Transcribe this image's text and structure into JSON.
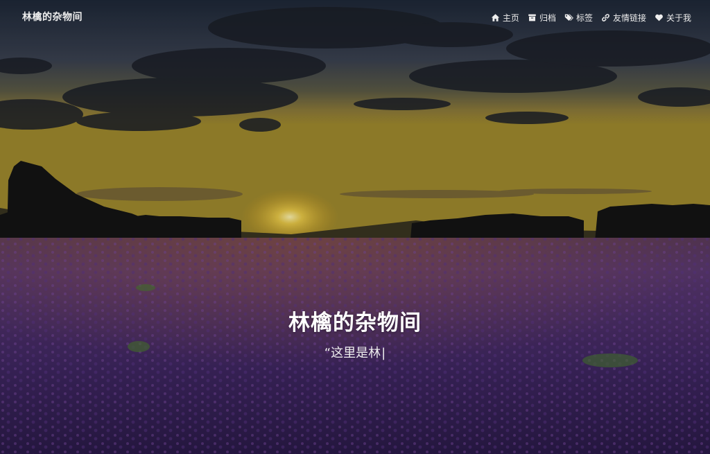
{
  "navbar": {
    "site_name": "林檎的杂物间",
    "menu": [
      {
        "label": "主页",
        "icon": "home-icon"
      },
      {
        "label": "归档",
        "icon": "archive-icon"
      },
      {
        "label": "标签",
        "icon": "tags-icon"
      },
      {
        "label": "友情链接",
        "icon": "link-icon"
      },
      {
        "label": "关于我",
        "icon": "heart-icon"
      }
    ]
  },
  "hero": {
    "title": "林檎的杂物间",
    "subtitle": "“这里是林",
    "cursor": "|"
  },
  "colors": {
    "text": "#eeeeee",
    "sky_top": "#1c2636",
    "sunset": "#c9a22a",
    "lavender": "#4a2a6a"
  }
}
